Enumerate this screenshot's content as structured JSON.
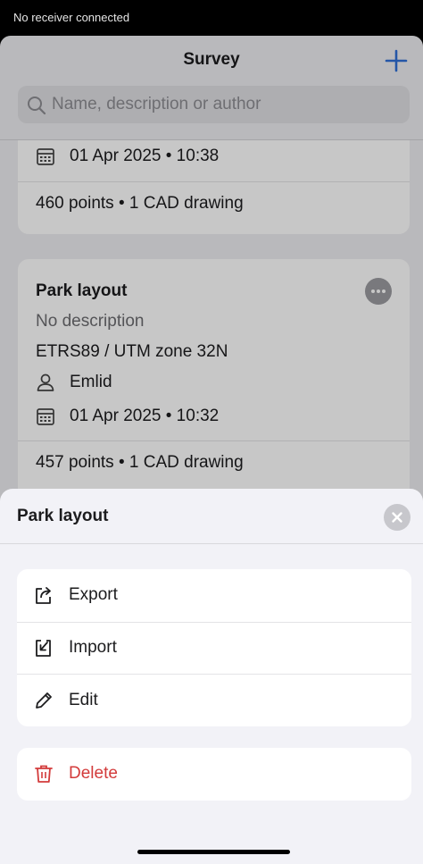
{
  "status_bar": {
    "text": "No receiver connected"
  },
  "nav": {
    "title": "Survey",
    "add_icon": "plus-icon"
  },
  "search": {
    "placeholder": "Name, description or author",
    "value": ""
  },
  "cards": [
    {
      "date": "01 Apr 2025 • 10:38",
      "footer": "460 points • 1 CAD drawing"
    },
    {
      "title": "Park layout",
      "description": "No description",
      "crs": "ETRS89 / UTM zone 32N",
      "author": "Emlid",
      "date": "01 Apr 2025 • 10:32",
      "footer": "457 points • 1 CAD drawing"
    }
  ],
  "sheet": {
    "title": "Park layout",
    "actions": [
      {
        "label": "Export",
        "icon": "export-icon"
      },
      {
        "label": "Import",
        "icon": "import-icon"
      },
      {
        "label": "Edit",
        "icon": "pencil-icon"
      }
    ],
    "delete": {
      "label": "Delete",
      "icon": "trash-icon"
    }
  },
  "colors": {
    "accent": "#2f6fd6",
    "destructive": "#d33b3b"
  }
}
